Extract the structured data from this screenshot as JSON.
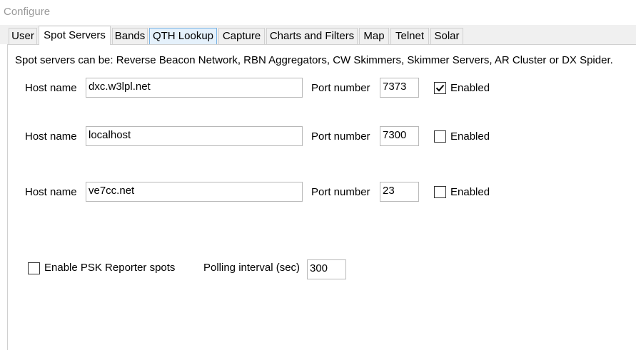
{
  "window": {
    "title": "Configure"
  },
  "tabs": [
    {
      "label": "User"
    },
    {
      "label": "Spot Servers"
    },
    {
      "label": "Bands"
    },
    {
      "label": "QTH Lookup"
    },
    {
      "label": "Capture"
    },
    {
      "label": "Charts and Filters"
    },
    {
      "label": "Map"
    },
    {
      "label": "Telnet"
    },
    {
      "label": "Solar"
    }
  ],
  "active_tab": "Spot Servers",
  "panel": {
    "description": "Spot servers can be: Reverse Beacon Network, RBN Aggregators, CW Skimmers, Skimmer Servers, AR Cluster or DX Spider.",
    "host_label": "Host name",
    "port_label": "Port number",
    "enabled_label": "Enabled",
    "servers": [
      {
        "host": "dxc.w3lpl.net",
        "port": "7373",
        "enabled": true
      },
      {
        "host": "localhost",
        "port": "7300",
        "enabled": false
      },
      {
        "host": "ve7cc.net",
        "port": "23",
        "enabled": false
      }
    ],
    "psk": {
      "label": "Enable PSK Reporter spots",
      "enabled": false,
      "polling_label": "Polling interval (sec)",
      "polling_value": "300"
    }
  }
}
